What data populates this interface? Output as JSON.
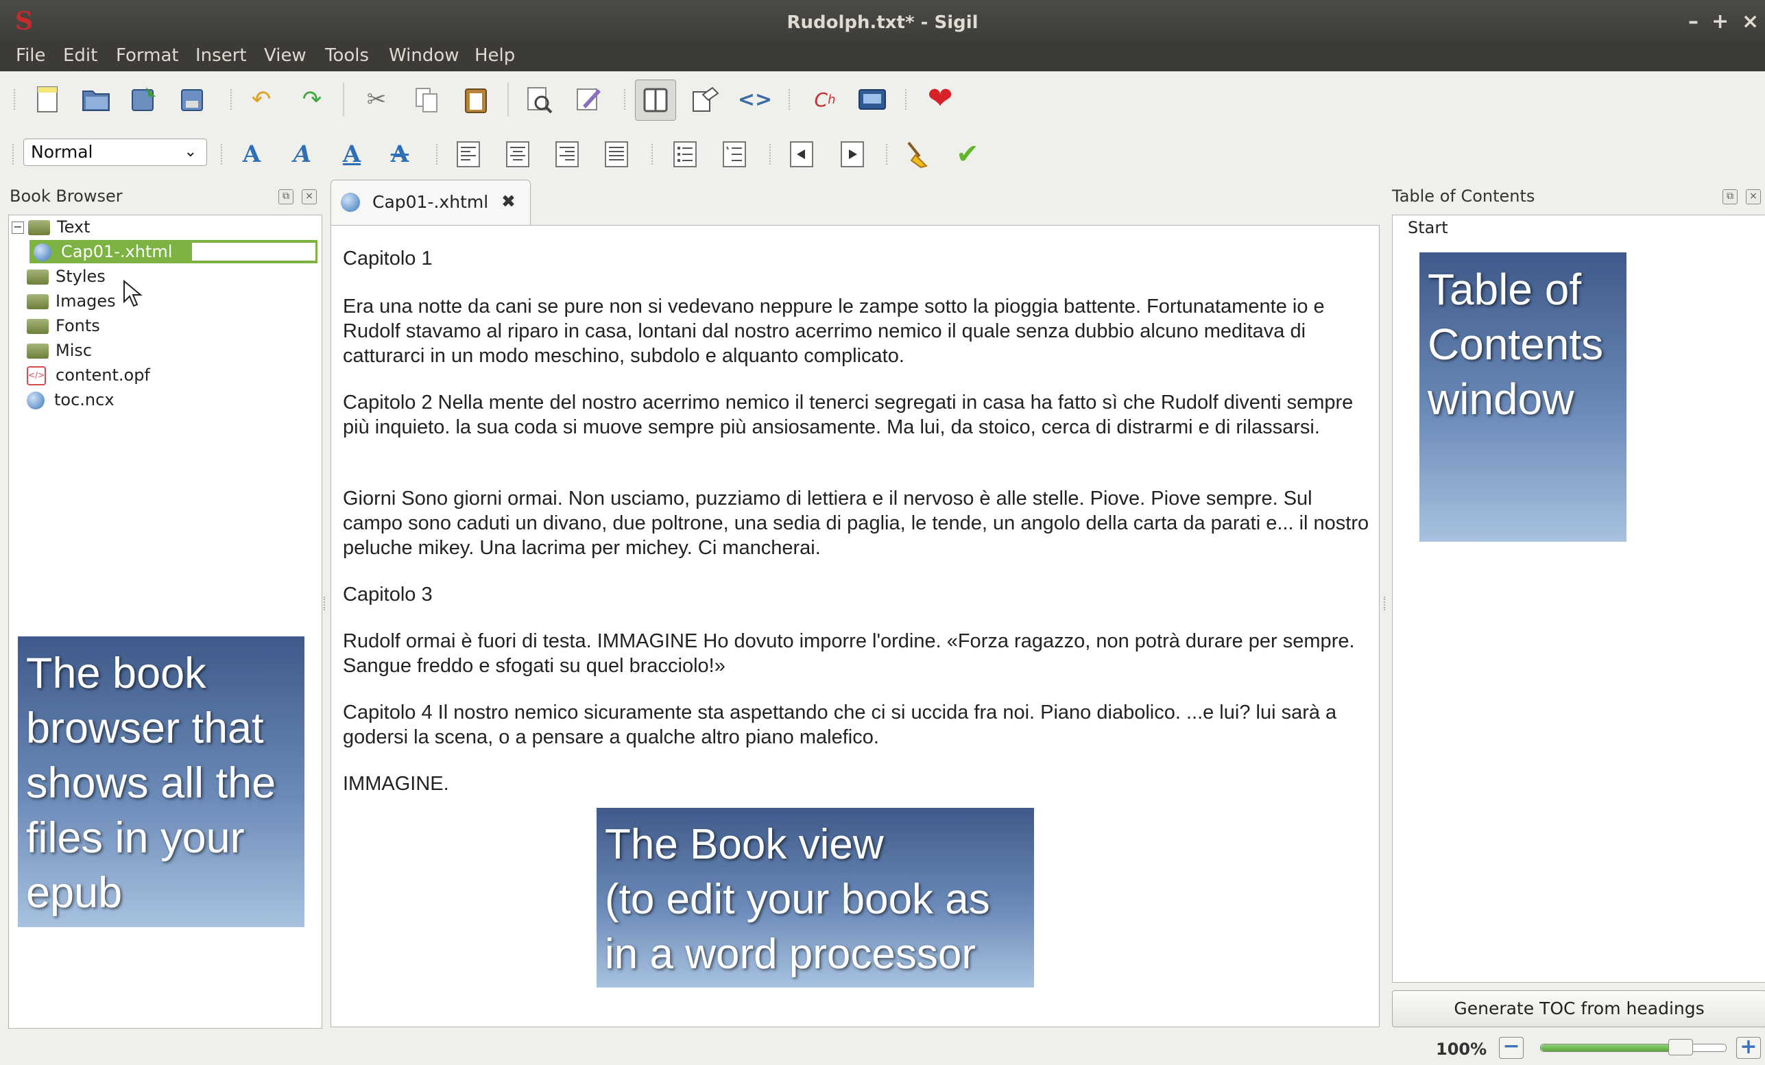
{
  "window": {
    "title": "Rudolph.txt* - Sigil",
    "logo": "S",
    "minimize": "–",
    "maximize": "+",
    "close": "×"
  },
  "menu": [
    "File",
    "Edit",
    "Format",
    "Insert",
    "View",
    "Tools",
    "Window",
    "Help"
  ],
  "toolbar": {
    "style_select_value": "Normal"
  },
  "book_browser": {
    "title": "Book Browser",
    "items": [
      {
        "label": "Text",
        "type": "folder",
        "expanded": true
      },
      {
        "label": "Cap01-.xhtml",
        "type": "file",
        "selected": true
      },
      {
        "label": "Styles",
        "type": "folder"
      },
      {
        "label": "Images",
        "type": "folder"
      },
      {
        "label": "Fonts",
        "type": "folder"
      },
      {
        "label": "Misc",
        "type": "folder"
      },
      {
        "label": "content.opf",
        "type": "opf"
      },
      {
        "label": "toc.ncx",
        "type": "ncx"
      }
    ]
  },
  "editor": {
    "tab_label": "Cap01-.xhtml",
    "tab_close": "✖",
    "paragraphs": [
      "Capitolo 1",
      "Era una notte da cani se pure non si vedevano neppure le zampe sotto la pioggia battente. Fortunatamente io e Rudolf stavamo al riparo in casa, lontani dal nostro acerrimo nemico il quale senza dubbio alcuno meditava di catturarci in un modo meschino, subdolo e alquanto complicato.",
      "Capitolo 2 Nella mente del nostro acerrimo nemico il tenerci segregati in casa ha fatto sì che Rudolf diventi sempre più inquieto. la sua coda si muove sempre più ansiosamente. Ma lui, da stoico, cerca di distrarmi e di rilassarsi.",
      "Giorni Sono giorni ormai. Non usciamo, puzziamo di lettiera e il nervoso è alle stelle. Piove. Piove sempre. Sul campo sono caduti un divano, due poltrone, una sedia di paglia, le tende, un angolo della carta da parati e... il nostro peluche mikey. Una lacrima per michey. Ci mancherai.",
      "Capitolo 3",
      "Rudolf ormai è fuori di testa. IMMAGINE Ho dovuto imporre l'ordine. «Forza ragazzo, non potrà durare per sempre. Sangue freddo e sfogati su quel bracciolo!»",
      "Capitolo 4 Il nostro nemico sicuramente sta aspettando che ci si uccida fra noi. Piano diabolico. ...e lui? lui sarà a godersi la scena, o a pensare a qualche altro piano malefico.",
      "IMMAGINE."
    ]
  },
  "toc": {
    "title": "Table of Contents",
    "items": [
      "Start"
    ],
    "generate_button": "Generate TOC from headings"
  },
  "status": {
    "zoom": "100%",
    "zoom_level": 0.75
  },
  "annotations": {
    "book_browser": [
      "The book",
      "browser that",
      "shows all the",
      "files in your",
      "epub"
    ],
    "book_view": [
      "The Book view",
      "(to edit your book as",
      "in a word processor"
    ],
    "toc": [
      "Table of",
      "Contents",
      "window"
    ]
  },
  "colors": {
    "titlebar": "#3c3b37",
    "selection": "#7cb342",
    "callout": "#5a78a8",
    "heart": "#d8222a",
    "check": "#5fb82c"
  }
}
